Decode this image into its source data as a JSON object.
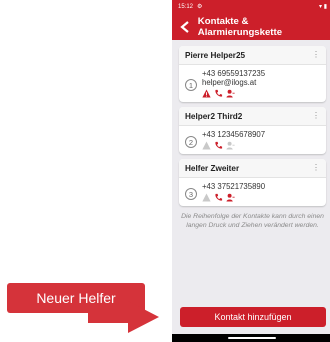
{
  "callout": {
    "label": "Neuer Helfer"
  },
  "status": {
    "time": "15:12",
    "right": "▾ ▮"
  },
  "appbar": {
    "title": "Kontakte & Alarmierungskette"
  },
  "contacts": [
    {
      "name": "Pierre Helper25",
      "position": "1",
      "phone": "+43 69559137235",
      "email": "helper@ilogs.at",
      "icons": {
        "alert": "active",
        "call": "active",
        "person": "active"
      }
    },
    {
      "name": "Helper2 Third2",
      "position": "2",
      "phone": "+43 12345678907",
      "email": "",
      "icons": {
        "alert": "inactive",
        "call": "active",
        "person": "inactive"
      }
    },
    {
      "name": "Helfer Zweiter",
      "position": "3",
      "phone": "+43 37521735890",
      "email": "",
      "icons": {
        "alert": "inactive",
        "call": "active",
        "person": "active"
      }
    }
  ],
  "hint": "Die Reihenfolge der Kontakte kann durch einen langen Druck und Ziehen verändert werden.",
  "add_button": {
    "label": "Kontakt hinzufügen"
  },
  "colors": {
    "primary": "#cc1f2a",
    "inactive_icon": "#c9c9c9",
    "background": "#ecebef"
  }
}
